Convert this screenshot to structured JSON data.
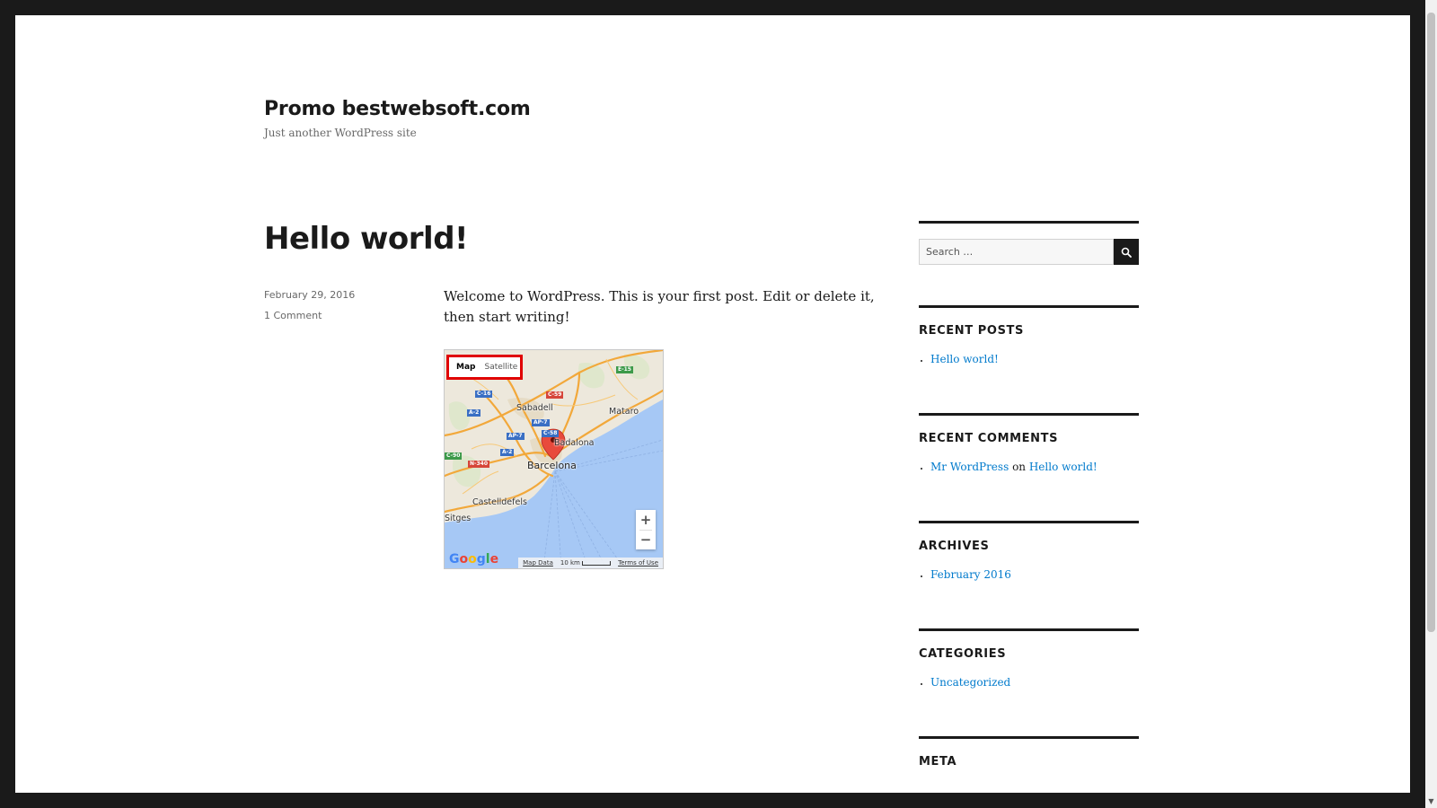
{
  "site": {
    "title": "Promo bestwebsoft.com",
    "description": "Just another WordPress site"
  },
  "post": {
    "title": "Hello world!",
    "date": "February 29, 2016",
    "comments": "1 Comment",
    "body": "Welcome to WordPress. This is your first post. Edit or delete it, then start writing!"
  },
  "map": {
    "type_map": "Map",
    "type_satellite": "Satellite",
    "zoom_in": "+",
    "zoom_out": "−",
    "logo": "Google",
    "map_data": "Map Data",
    "scale": "10 km",
    "terms": "Terms of Use",
    "places": {
      "sabadell": "Sabadell",
      "mataro": "Mataro",
      "badalona": "Badalona",
      "barcelona": "Barcelona",
      "castelldefels": "Castelldefels",
      "sitges": "Sitges"
    },
    "roads": {
      "c16": "C-16",
      "c59": "C-59",
      "e15": "E-15",
      "a2a": "A-2",
      "ap7a": "AP-7",
      "c58": "C-58",
      "ap7b": "AP-7",
      "a2b": "A-2",
      "c90": "C-90",
      "n340": "N-340"
    },
    "colors": {
      "water": "#a6c8f5",
      "land": "#ede8dc",
      "highway": "#f2a83a",
      "marker": "#e84a3c",
      "highlight": "#e00000"
    }
  },
  "sidebar": {
    "search_placeholder": "Search …",
    "search_icon": "magnifier-icon",
    "recent_posts": {
      "title": "RECENT POSTS",
      "items": [
        "Hello world!"
      ]
    },
    "recent_comments": {
      "title": "RECENT COMMENTS",
      "author": "Mr WordPress",
      "on": "on",
      "post": "Hello world!"
    },
    "archives": {
      "title": "ARCHIVES",
      "items": [
        "February 2016"
      ]
    },
    "categories": {
      "title": "CATEGORIES",
      "items": [
        "Uncategorized"
      ]
    },
    "meta": {
      "title": "META"
    }
  }
}
